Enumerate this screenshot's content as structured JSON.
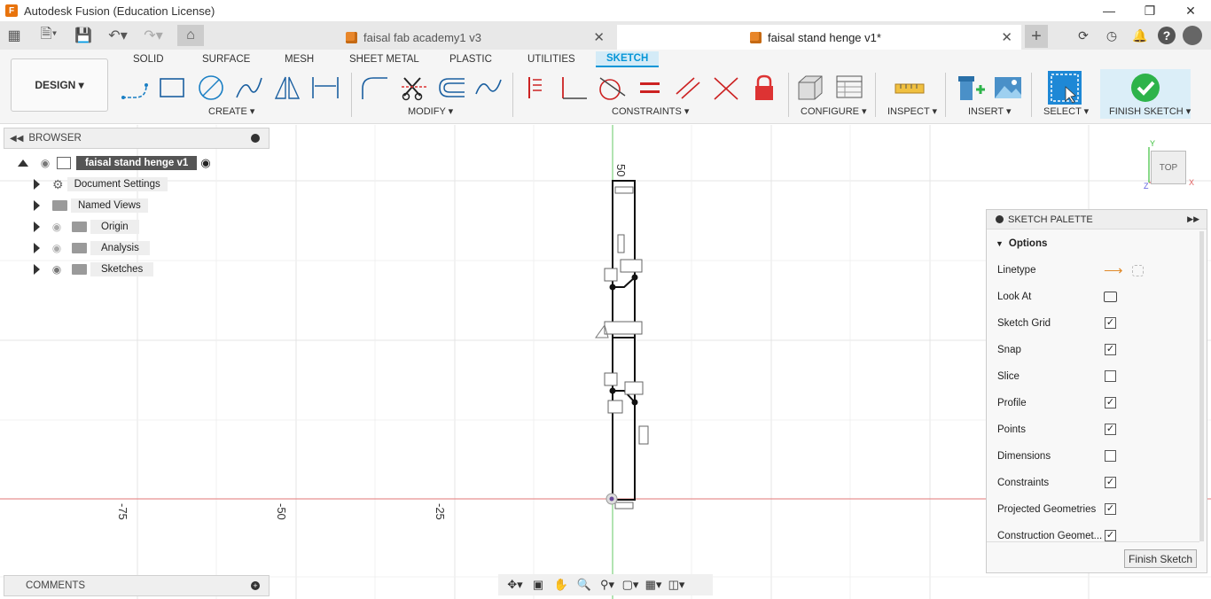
{
  "titlebar": {
    "title": "Autodesk Fusion (Education License)",
    "logo": "F"
  },
  "tabs": [
    {
      "label": "faisal fab academy1 v3",
      "active": false
    },
    {
      "label": "faisal stand henge v1*",
      "active": true
    }
  ],
  "workspace": {
    "mode": "DESIGN",
    "tabs": [
      "SOLID",
      "SURFACE",
      "MESH",
      "SHEET METAL",
      "PLASTIC",
      "UTILITIES",
      "SKETCH"
    ],
    "active_tab": "SKETCH",
    "groups": [
      "CREATE ▾",
      "MODIFY ▾",
      "CONSTRAINTS ▾",
      "CONFIGURE ▾",
      "INSPECT ▾",
      "INSERT ▾",
      "SELECT ▾",
      "FINISH SKETCH ▾"
    ]
  },
  "browser": {
    "title": "BROWSER",
    "root": "faisal stand henge v1",
    "items": [
      "Document Settings",
      "Named Views",
      "Origin",
      "Analysis",
      "Sketches"
    ]
  },
  "comments": {
    "title": "COMMENTS"
  },
  "palette": {
    "title": "SKETCH PALETTE",
    "section": "Options",
    "rows": [
      {
        "label": "Linetype",
        "type": "icons"
      },
      {
        "label": "Look At",
        "type": "icon"
      },
      {
        "label": "Sketch Grid",
        "checked": true
      },
      {
        "label": "Snap",
        "checked": true
      },
      {
        "label": "Slice",
        "checked": false
      },
      {
        "label": "Profile",
        "checked": true
      },
      {
        "label": "Points",
        "checked": true
      },
      {
        "label": "Dimensions",
        "checked": false
      },
      {
        "label": "Constraints",
        "checked": true
      },
      {
        "label": "Projected Geometries",
        "checked": true
      },
      {
        "label": "Construction Geomet...",
        "checked": true
      }
    ],
    "finish_button": "Finish Sketch"
  },
  "viewcube": {
    "label": "TOP"
  },
  "axis_labels": {
    "x_ticks": [
      "-75",
      "-50",
      "-25"
    ],
    "y_tick": "50"
  },
  "colors": {
    "accent": "#0696d7",
    "x_axis": "#e06060",
    "y_axis": "#3bbf3b",
    "finish_green": "#2db34a"
  }
}
